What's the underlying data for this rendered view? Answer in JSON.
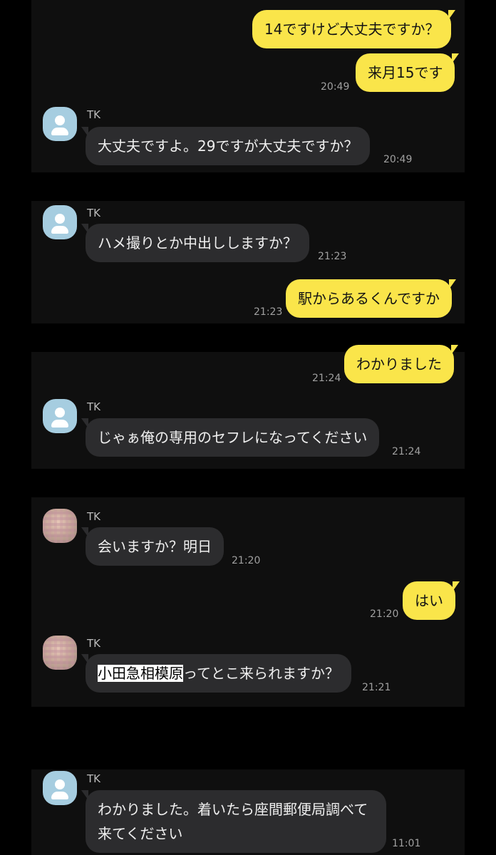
{
  "colors": {
    "outgoing_bubble": "#fae54a",
    "incoming_bubble": "#2c2c2e",
    "background": "#000000",
    "panel": "#0f0f0f"
  },
  "messages": {
    "m1": {
      "text": "14ですけど大丈夫ですか？"
    },
    "m2": {
      "text": "来月15です",
      "time": "20:49"
    },
    "m3": {
      "sender": "TK",
      "text": "大丈夫ですよ。29ですが大丈夫ですか？",
      "time": "20:49",
      "avatar": "person-icon"
    },
    "m4": {
      "sender": "TK",
      "text": "ハメ撮りとか中出ししますか？",
      "time": "21:23",
      "avatar": "person-icon"
    },
    "m5": {
      "text": "駅からあるくんですか",
      "time": "21:23"
    },
    "m6": {
      "text": "わかりました",
      "time": "21:24"
    },
    "m7": {
      "sender": "TK",
      "text": "じゃぁ俺の専用のセフレになってください",
      "time": "21:24",
      "avatar": "person-icon"
    },
    "m8": {
      "sender": "TK",
      "text": "会いますか？明日",
      "time": "21:20",
      "avatar": "photo-avatar"
    },
    "m9": {
      "text": "はい",
      "time": "21:20"
    },
    "m10": {
      "sender": "TK",
      "text_highlight": "小田急相模原",
      "text_rest": "ってとこ来られますか？",
      "time": "21:21",
      "avatar": "photo-avatar"
    },
    "m11": {
      "sender": "TK",
      "line1": "わかりました。着いたら座間郵便局調べて",
      "line2": "来てください",
      "time": "11:01",
      "avatar": "person-icon"
    }
  }
}
